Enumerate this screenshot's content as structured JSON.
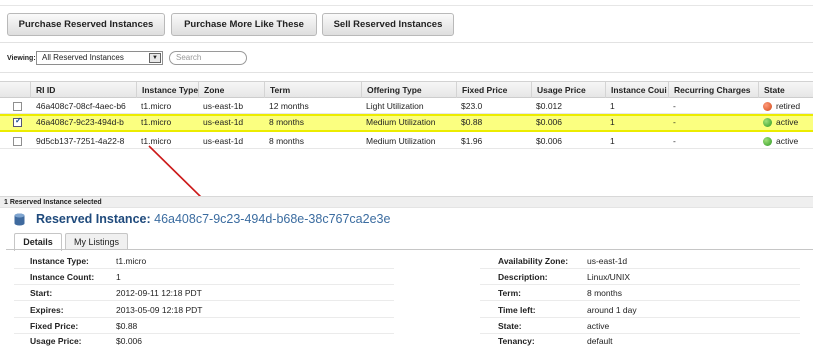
{
  "toolbar": {
    "purchase_reserved": "Purchase Reserved Instances",
    "purchase_more": "Purchase More Like These",
    "sell_reserved": "Sell Reserved Instances"
  },
  "filter": {
    "viewing_label": "Viewing:",
    "selected_option": "All Reserved Instances",
    "search_placeholder": "Search"
  },
  "table": {
    "columns": [
      "RI ID",
      "Instance Type",
      "Zone",
      "Term",
      "Offering Type",
      "Fixed Price",
      "Usage Price",
      "Instance Coui",
      "Recurring Charges",
      "State"
    ],
    "rows": [
      {
        "checked": false,
        "ri_id": "46a408c7-08cf-4aec-b6",
        "instance_type": "t1.micro",
        "zone": "us-east-1b",
        "term": "12 months",
        "offering_type": "Light Utilization",
        "fixed_price": "$23.0",
        "usage_price": "$0.012",
        "instance_count": "1",
        "recurring_charges": "-",
        "state": "retired",
        "state_color": "#e0592a"
      },
      {
        "checked": true,
        "ri_id": "46a408c7-9c23-494d-b",
        "instance_type": "t1.micro",
        "zone": "us-east-1d",
        "term": "8 months",
        "offering_type": "Medium Utilization",
        "fixed_price": "$0.88",
        "usage_price": "$0.006",
        "instance_count": "1",
        "recurring_charges": "-",
        "state": "active",
        "state_color": "#3aa42d"
      },
      {
        "checked": false,
        "ri_id": "9d5cb137-7251-4a22-8",
        "instance_type": "t1.micro",
        "zone": "us-east-1d",
        "term": "8 months",
        "offering_type": "Medium Utilization",
        "fixed_price": "$1.96",
        "usage_price": "$0.006",
        "instance_count": "1",
        "recurring_charges": "-",
        "state": "active",
        "state_color": "#3aa42d"
      }
    ]
  },
  "selection": {
    "count_text": "1 Reserved Instance selected"
  },
  "detail": {
    "title_label": "Reserved Instance:",
    "title_id": "46a408c7-9c23-494d-b68e-38c767ca2e3e",
    "tabs": [
      "Details",
      "My Listings"
    ],
    "left": [
      {
        "label": "Instance Type:",
        "value": "t1.micro"
      },
      {
        "label": "Instance Count:",
        "value": "1"
      },
      {
        "label": "Start:",
        "value": "2012-09-11 12:18 PDT"
      },
      {
        "label": "Expires:",
        "value": "2013-05-09 12:18 PDT"
      },
      {
        "label": "Fixed Price:",
        "value": "$0.88"
      },
      {
        "label": "Usage Price:",
        "value": "$0.006"
      }
    ],
    "right": [
      {
        "label": "Availability Zone:",
        "value": "us-east-1d"
      },
      {
        "label": "Description:",
        "value": "Linux/UNIX"
      },
      {
        "label": "Term:",
        "value": "8 months"
      },
      {
        "label": "Time left:",
        "value": "around 1 day"
      },
      {
        "label": "State:",
        "value": "active"
      },
      {
        "label": "Tenancy:",
        "value": "default"
      }
    ]
  },
  "colors": {
    "highlight": "#fbff80",
    "title": "#1f4a7c",
    "arrow": "#cc1a1a"
  }
}
